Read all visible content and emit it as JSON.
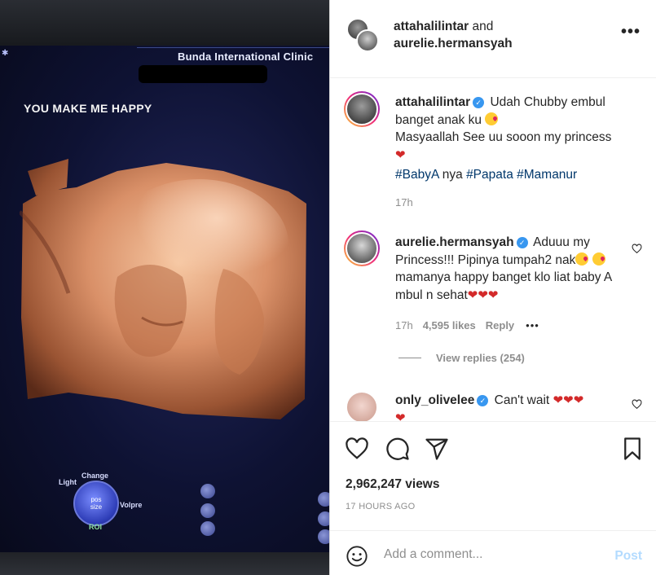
{
  "media": {
    "clinic_name": "Bunda International Clinic",
    "overlay_text": "YOU MAKE ME HAPPY",
    "controls": {
      "light": "Light",
      "change": "Change",
      "knob_line1": "pos",
      "knob_line2": "size",
      "volpre": "Volpre",
      "roi": "ROI"
    }
  },
  "header": {
    "user1": "attahalilintar",
    "joiner": " and",
    "user2": "aurelie.hermansyah",
    "more_label": "•••"
  },
  "comments": [
    {
      "username": "attahalilintar",
      "line1": "Udah Chubby embul banget anak ku",
      "line2": "Masyaallah See uu sooon my princess",
      "hashtags": [
        "#BabyA",
        "nya",
        "#Papata",
        "#Mamanur"
      ],
      "time": "17h"
    },
    {
      "username": "aurelie.hermansyah",
      "text_a": "Aduuu my Princess!!! Pipinya tumpah2 nak",
      "text_b": "mamanya happy banget klo liat baby A mbul n sehat",
      "time": "17h",
      "likes": "4,595 likes",
      "reply": "Reply",
      "view_replies": "View replies (254)"
    },
    {
      "username": "only_olivelee",
      "text": "Can't wait"
    }
  ],
  "stats": {
    "views": "2,962,247 views",
    "posted": "17 HOURS AGO"
  },
  "comment_box": {
    "placeholder": "Add a comment...",
    "post_label": "Post"
  },
  "colors": {
    "accent_blue": "#3897f0",
    "hashtag": "#00376b",
    "heart_red": "#d32a2a",
    "muted": "#8e8e8e",
    "post_disabled": "#b3dbff"
  }
}
